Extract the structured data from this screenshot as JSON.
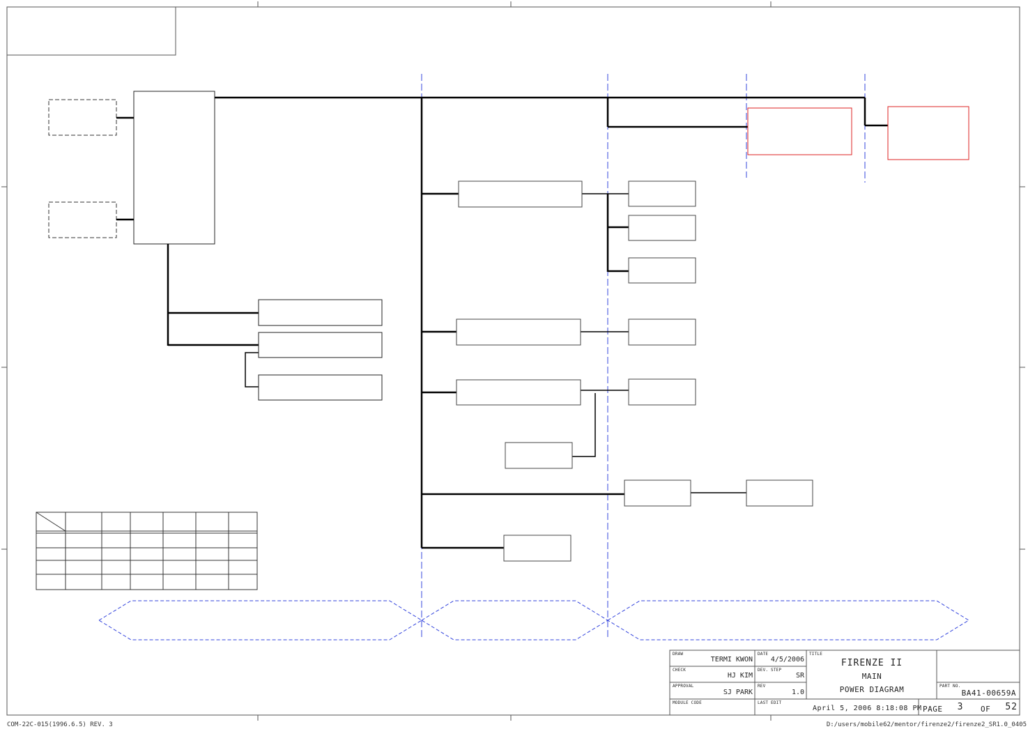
{
  "title_block": {
    "draw_label": "DRAW",
    "draw_value": "TERMI KWON",
    "check_label": "CHECK",
    "check_value": "HJ KIM",
    "approval_label": "APPROVAL",
    "approval_value": "SJ PARK",
    "module_code_label": "MODULE CODE",
    "date_label": "DATE",
    "date_value": "4/5/2006",
    "dev_step_label": "DEV. STEP",
    "dev_step_value": "SR",
    "rev_label": "REV",
    "rev_value": "1.0",
    "last_edit_label": "LAST EDIT",
    "last_edit_value": "April 5, 2006  8:18:08 PM",
    "title_label": "TITLE",
    "title_line1": "FIRENZE II",
    "title_line2": "MAIN",
    "title_line3": "POWER DIAGRAM",
    "part_no_label": "PART NO.",
    "part_no_value": "BA41-00659A",
    "page_label": "PAGE",
    "page_value": "3",
    "of_label": "OF",
    "of_value": "52"
  },
  "footer": {
    "form_code": "COM-22C-015(1996.6.5) REV. 3",
    "file_path": "D:/users/mobile62/mentor/firenze2/firenze2_SR1.0_0405"
  },
  "colors": {
    "line": "#000000",
    "box": "#444444",
    "zone": "#3344dd",
    "highlight": "#dd2222"
  }
}
